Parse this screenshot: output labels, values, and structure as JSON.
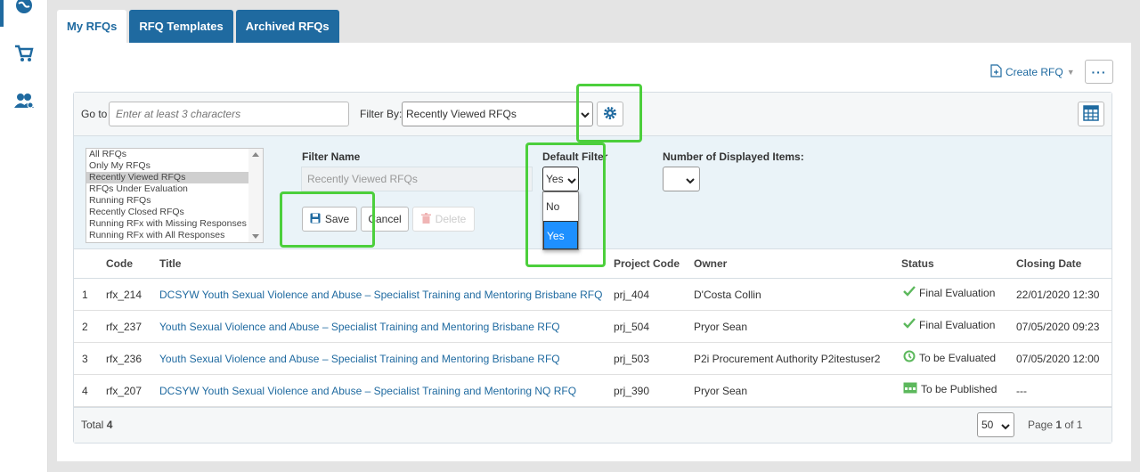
{
  "tabs": [
    {
      "label": "My RFQs",
      "active": true
    },
    {
      "label": "RFQ Templates",
      "active": false
    },
    {
      "label": "Archived RFQs",
      "active": false
    }
  ],
  "nav": {
    "icons": [
      "globe-icon",
      "cart-icon",
      "users-icon"
    ]
  },
  "toolbar": {
    "create_label": "Create RFQ",
    "more_label": "···",
    "goto_label": "Go to",
    "goto_placeholder": "Enter at least 3 characters",
    "filterby_label": "Filter By:",
    "filter_value": "Recently Viewed RFQs"
  },
  "filter_panel": {
    "list_options": [
      "All RFQs",
      "Only My RFQs",
      "Recently Viewed RFQs",
      "RFQs Under Evaluation",
      "Running RFQs",
      "Recently Closed RFQs",
      "Running RFx with Missing Responses",
      "Running RFx with All Responses"
    ],
    "list_selected_index": 2,
    "filter_name_label": "Filter Name",
    "filter_name_value": "Recently Viewed RFQs",
    "default_filter_label": "Default Filter",
    "default_value": "Yes",
    "default_options": [
      "No",
      "Yes"
    ],
    "num_items_label": "Number of Displayed Items:",
    "save_label": "Save",
    "cancel_label": "Cancel",
    "delete_label": "Delete"
  },
  "table": {
    "headers": [
      "Code",
      "Title",
      "Project Code",
      "Owner",
      "Status",
      "Closing Date"
    ],
    "rows": [
      {
        "num": "1",
        "code": "rfx_214",
        "title": "DCSYW Youth Sexual Violence and Abuse – Specialist Training and Mentoring Brisbane RFQ",
        "project": "prj_404",
        "owner": "D'Costa Collin",
        "status": "Final Evaluation",
        "status_icon": "check-icon",
        "closing": "22/01/2020 12:30"
      },
      {
        "num": "2",
        "code": "rfx_237",
        "title": "Youth Sexual Violence and Abuse – Specialist Training and Mentoring Brisbane RFQ",
        "project": "prj_504",
        "owner": "Pryor Sean",
        "status": "Final Evaluation",
        "status_icon": "check-icon",
        "closing": "07/05/2020 09:23"
      },
      {
        "num": "3",
        "code": "rfx_236",
        "title": "Youth Sexual Violence and Abuse – Specialist Training and Mentoring Brisbane RFQ",
        "project": "prj_503",
        "owner": "P2i Procurement Authority P2itestuser2",
        "status": "To be Evaluated",
        "status_icon": "clock-icon",
        "closing": "07/05/2020 12:00"
      },
      {
        "num": "4",
        "code": "rfx_207",
        "title": "DCSYW Youth Sexual Violence and Abuse – Specialist Training and Mentoring NQ RFQ",
        "project": "prj_390",
        "owner": "Pryor Sean",
        "status": "To be Published",
        "status_icon": "calendar-icon",
        "closing": "---"
      }
    ]
  },
  "footer": {
    "total_label": "Total",
    "total_count": "4",
    "page_size": "50",
    "page_label": "Page",
    "page_current": "1",
    "page_of": "of 1"
  },
  "colors": {
    "accent": "#1f6aa0",
    "highlight": "#4ccf3c",
    "status_green": "#5cb85c"
  }
}
